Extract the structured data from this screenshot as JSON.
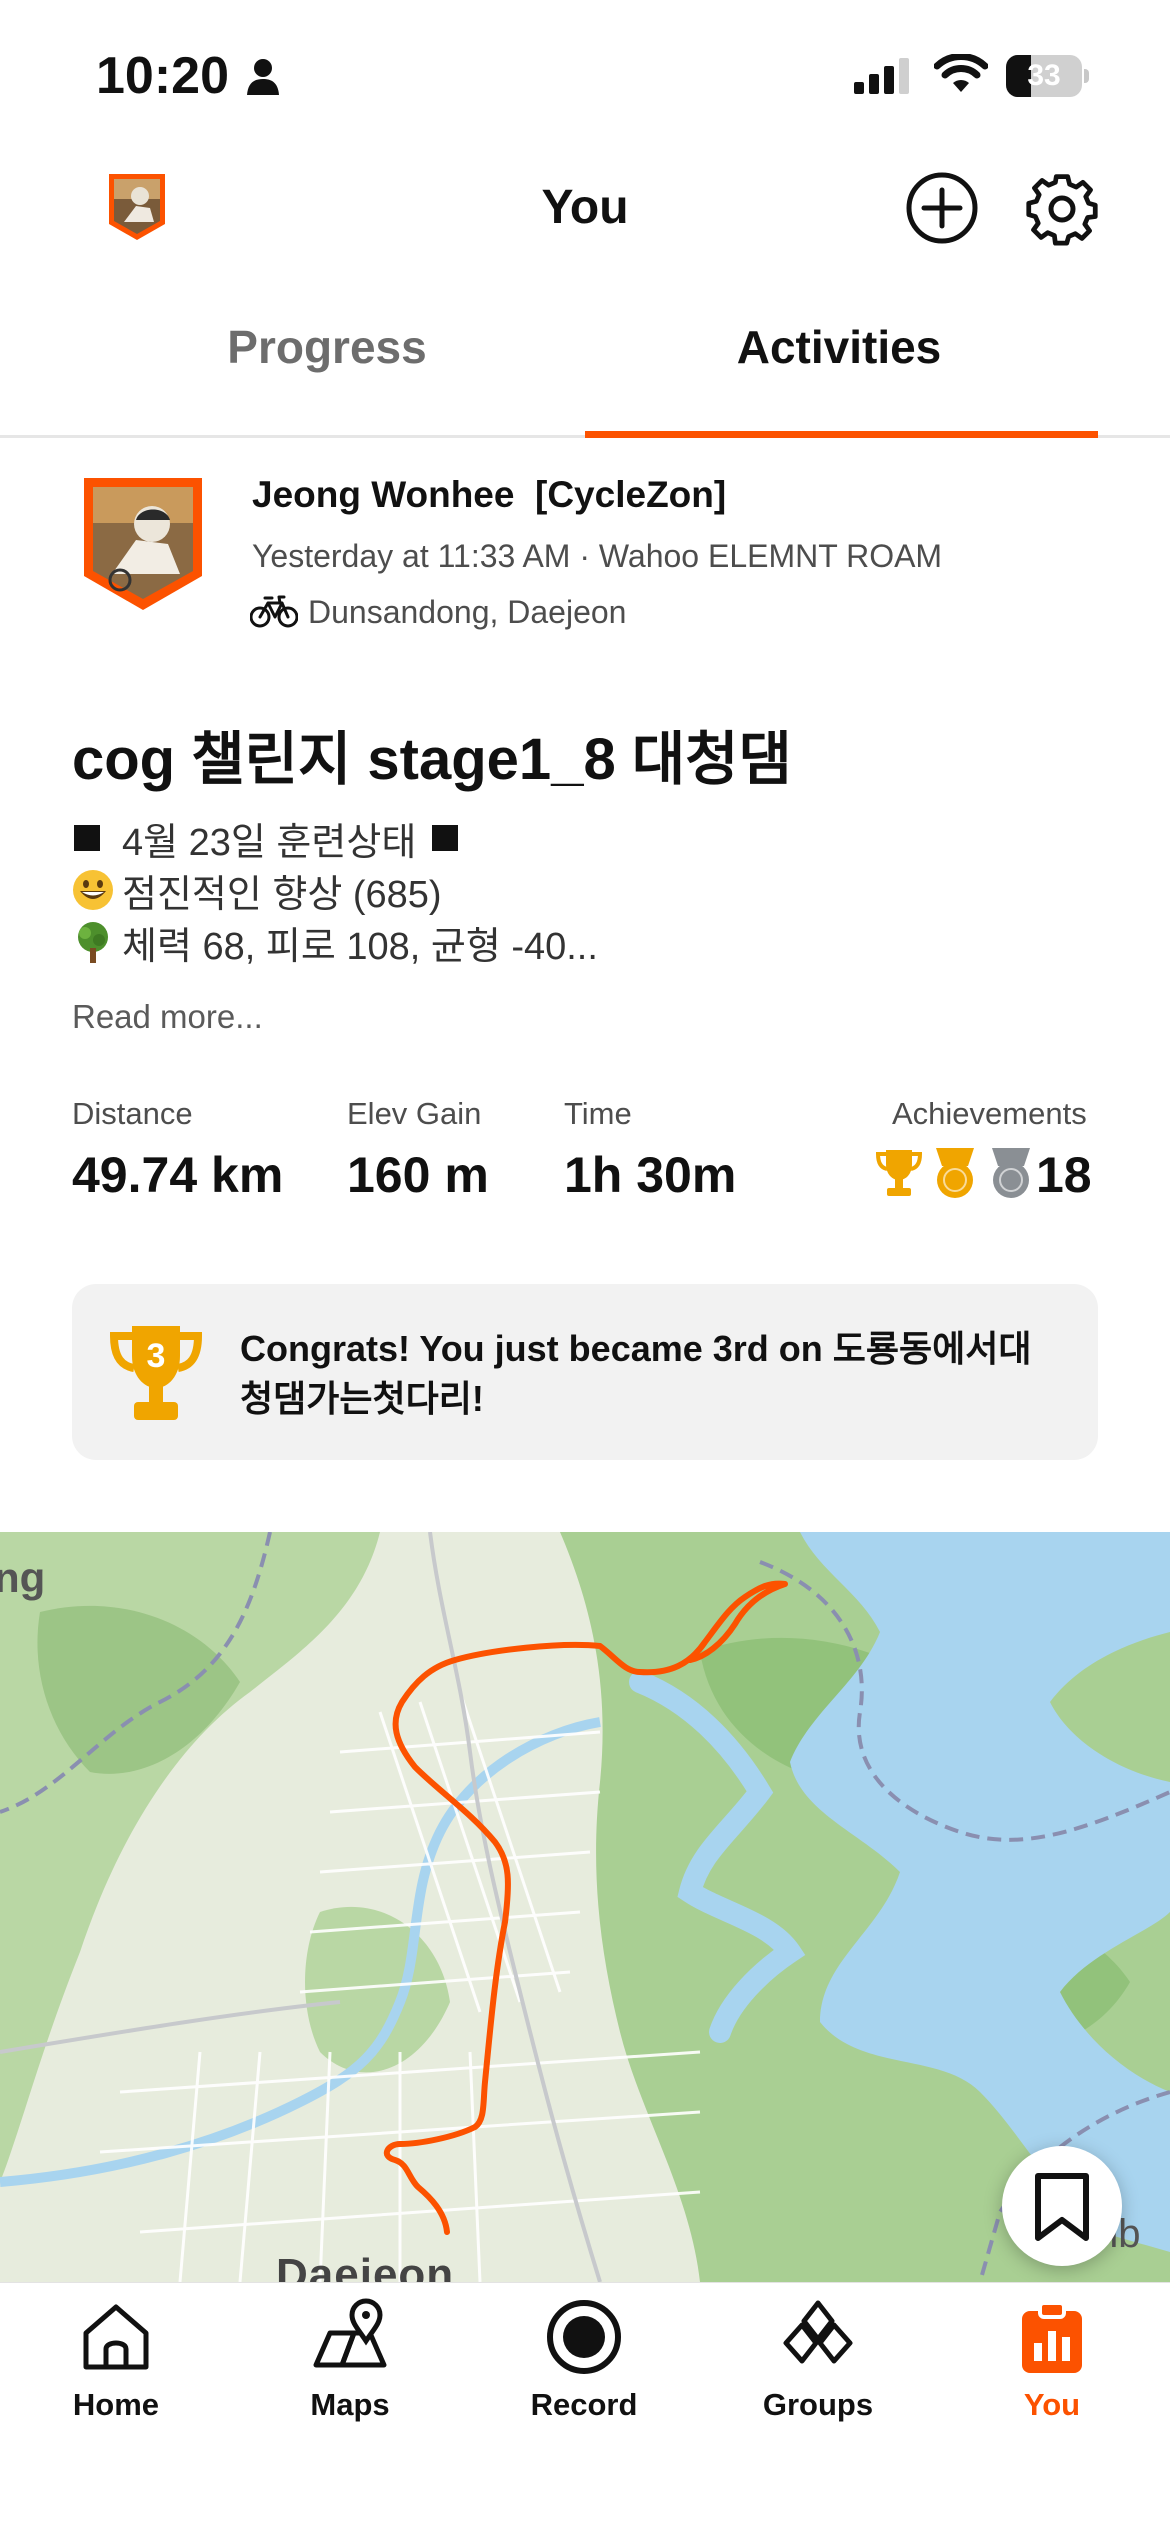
{
  "status_bar": {
    "time": "10:20",
    "battery": "33"
  },
  "header": {
    "title": "You"
  },
  "tabs": [
    {
      "label": "Progress"
    },
    {
      "label": "Activities"
    }
  ],
  "activity": {
    "athlete_name": "Jeong Wonhee  [CycleZon]",
    "meta": "Yesterday at 11:33 AM · Wahoo ELEMNT ROAM",
    "location": "Dunsandong, Daejeon",
    "title": "cog 챌린지 stage1_8 대청댐",
    "description_lines": [
      "4월 23일 훈련상태",
      "점진적인 향상 (685)",
      "체력 68, 피로 108, 균형 -40..."
    ],
    "read_more": "Read more...",
    "stats": {
      "distance": {
        "label": "Distance",
        "value": "49.74 km"
      },
      "elev_gain": {
        "label": "Elev Gain",
        "value": "160 m"
      },
      "time": {
        "label": "Time",
        "value": "1h 30m"
      },
      "achievements": {
        "label": "Achievements",
        "value": "18"
      }
    },
    "congrats": {
      "rank": "3",
      "text": "Congrats! You just became 3rd on 도룡동에서대청댐가는첫다리!"
    }
  },
  "map": {
    "label_left": "ng",
    "label_right": "nb",
    "label_city": "Daejeon",
    "route_color": "#fc5200"
  },
  "nav": [
    {
      "label": "Home",
      "icon": "home-icon"
    },
    {
      "label": "Maps",
      "icon": "maps-icon"
    },
    {
      "label": "Record",
      "icon": "record-icon"
    },
    {
      "label": "Groups",
      "icon": "groups-icon"
    },
    {
      "label": "You",
      "icon": "you-icon"
    }
  ],
  "colors": {
    "accent": "#fc5200",
    "gold": "#f0a500",
    "silver": "#8a8f94"
  }
}
